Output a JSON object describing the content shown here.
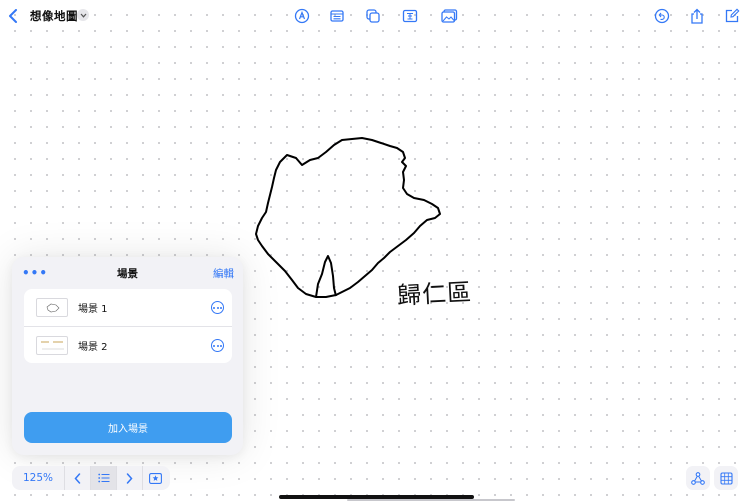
{
  "header": {
    "title": "想像地圖"
  },
  "toolbar": {
    "icons": [
      "pen-icon",
      "note-icon",
      "shape-icon",
      "text-icon",
      "image-icon"
    ],
    "right_icons": [
      "undo-icon",
      "share-icon",
      "new-board-icon"
    ]
  },
  "canvas": {
    "handwriting": "歸仁區"
  },
  "scenes_panel": {
    "title": "場景",
    "edit_label": "編輯",
    "more_label": "•••",
    "scenes": [
      {
        "label": "場景 1"
      },
      {
        "label": "場景 2"
      }
    ],
    "add_label": "加入場景"
  },
  "bottom_bar": {
    "zoom": "125%"
  },
  "colors": {
    "accent": "#3478f6",
    "add_button": "#3f9df0",
    "panel_bg": "#f2f2f6"
  }
}
